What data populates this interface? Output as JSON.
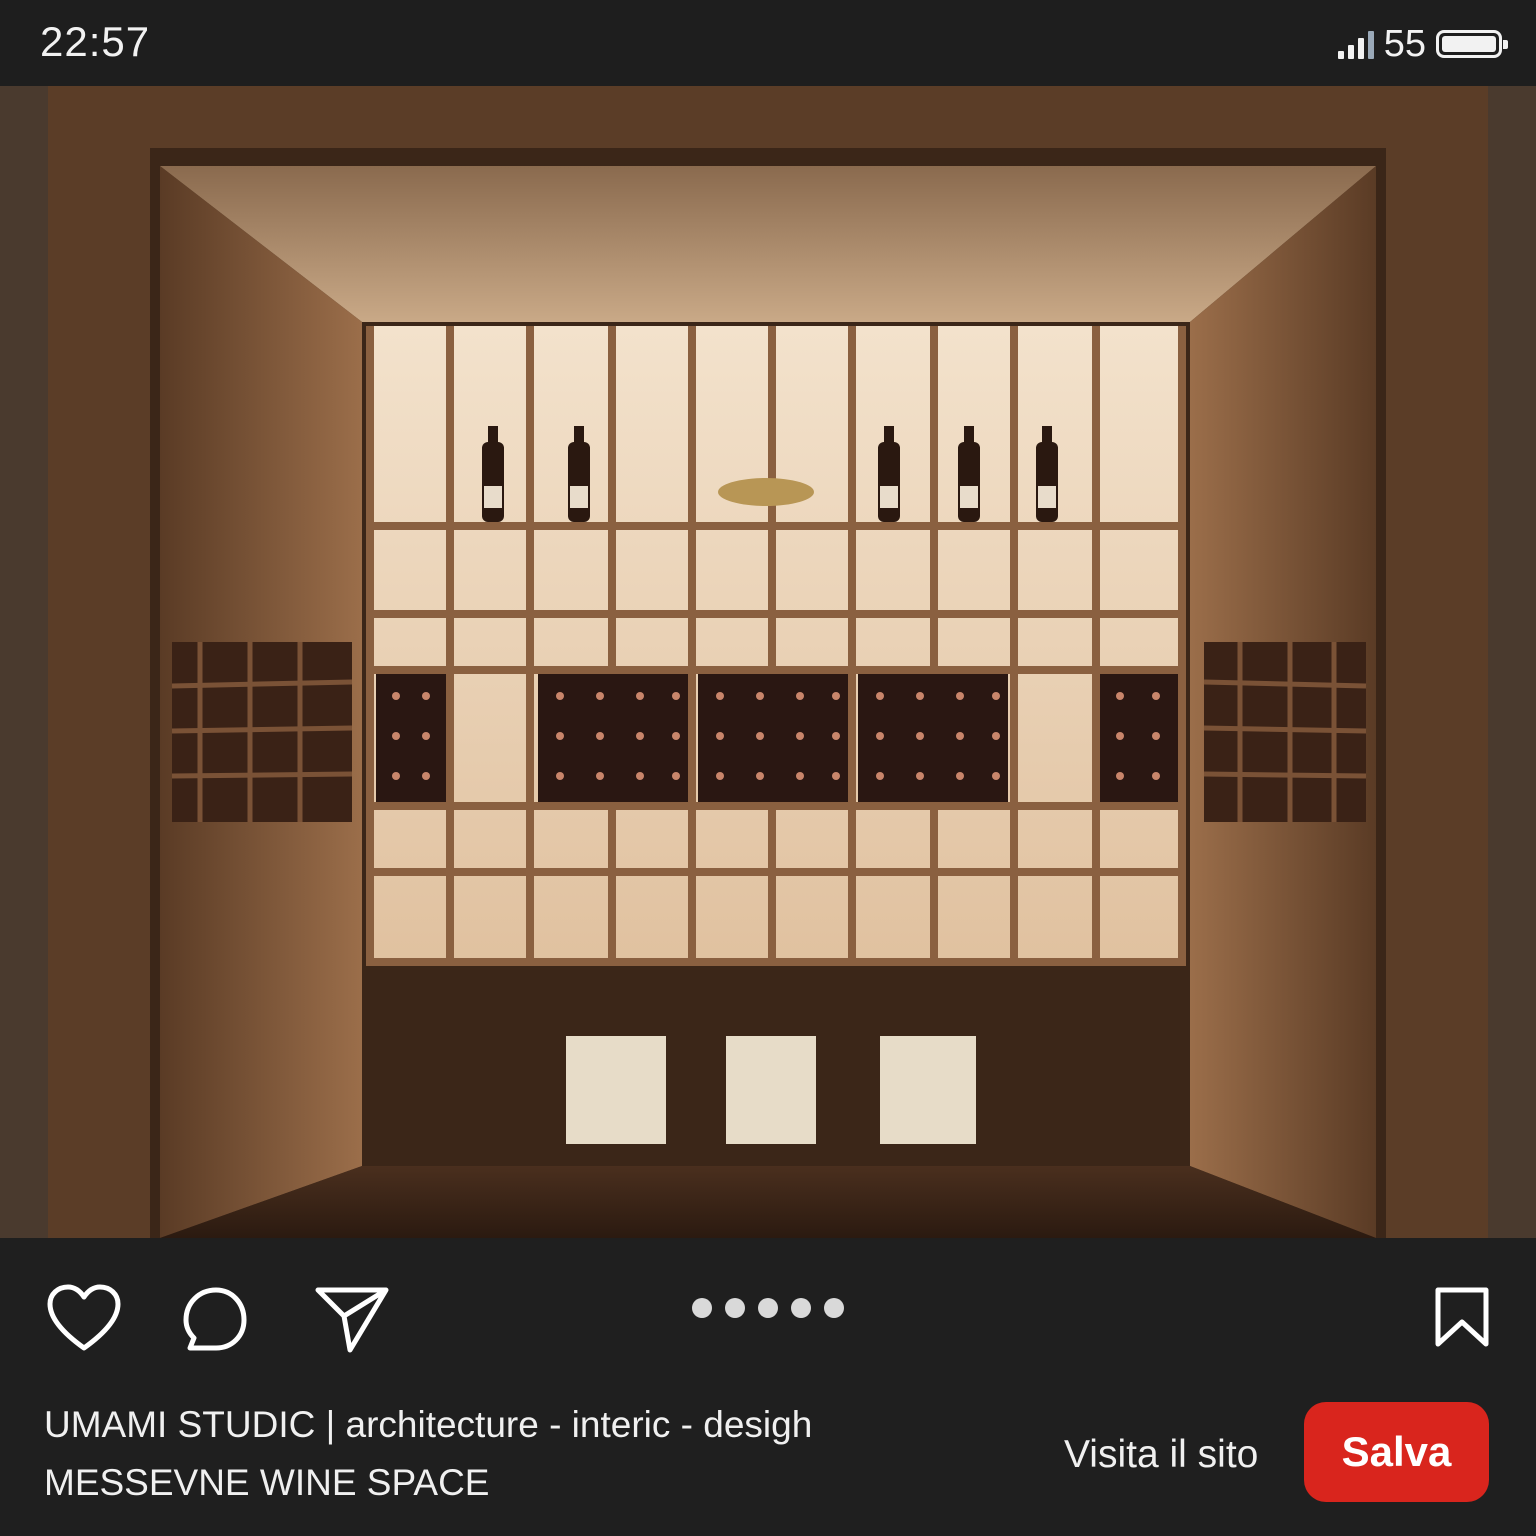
{
  "status_bar": {
    "time": "22:57",
    "battery_percent": "55",
    "icons": [
      "signal-icon",
      "battery-icon"
    ]
  },
  "post": {
    "image_alt": "Illuminated walnut wine cellar with open shelving",
    "carousel": {
      "total": 5,
      "active_index": 0
    }
  },
  "actions": {
    "icons": [
      "heart-icon",
      "comment-icon",
      "send-icon",
      "bookmark-icon"
    ]
  },
  "caption": {
    "author": "UMAMI STUDIC | architecture - interic - desigh",
    "title": "MESSEVNE WINE SPACE"
  },
  "cta": {
    "visit_label": "Visita il sito",
    "save_label": "Salva",
    "save_color": "#d9251d"
  }
}
